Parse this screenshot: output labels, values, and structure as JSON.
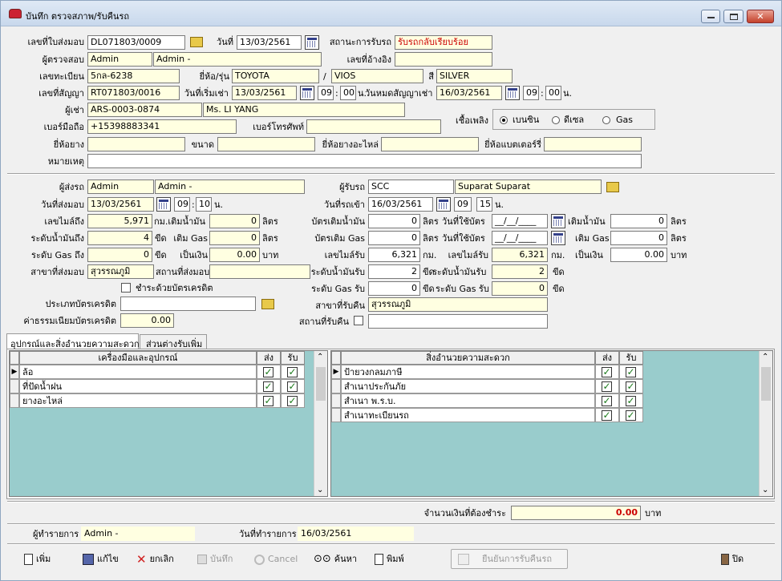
{
  "window": {
    "title": "บันทึก ตรวจสภาพ/รับคืนรถ"
  },
  "head": {
    "l_delivery_no": "เลขที่ใบส่งมอบ",
    "delivery_no": "DL071803/0009",
    "l_date": "วันที่",
    "date": "13/03/2561",
    "l_status": "สถานะการรับรถ",
    "status": "รับรถกลับเรียบร้อย",
    "l_inspector": "ผู้ตรวจสอบ",
    "inspector_code": "Admin",
    "inspector_name": "Admin -",
    "l_ref_no": "เลขที่อ้างอิง",
    "ref_no": "",
    "l_plate": "เลขทะเบียน",
    "plate": "5กล-6238",
    "l_brand_model": "ยี่ห้อ/รุ่น",
    "brand": "TOYOTA",
    "slash": "/",
    "model": "VIOS",
    "l_color": "สี",
    "color": "SILVER",
    "l_contract_no": "เลขที่สัญญา",
    "contract_no": "RT071803/0016",
    "l_rent_start": "วันที่เริ่มเช่า",
    "rent_start": "13/03/2561",
    "start_h": "09",
    "start_m": "00",
    "l_n1": "น.",
    "l_contract_end": "วันหมดสัญญาเช่า",
    "contract_end": "16/03/2561",
    "end_h": "09",
    "end_m": "00",
    "l_n2": "น.",
    "l_renter": "ผู้เช่า",
    "renter_code": "ARS-0003-0874",
    "renter_name": "Ms. LI YANG",
    "l_mobile": "เบอร์มือถือ",
    "mobile": "+15398883341",
    "l_phone": "เบอร์โทรศัพท์",
    "phone": "",
    "l_fuel": "เชื้อเพลิง",
    "fuel_options": [
      "เบนซิน",
      "ดีเซล",
      "Gas"
    ],
    "l_tire_brand": "ยี่ห้อยาง",
    "tire_brand": "",
    "l_size": "ขนาด",
    "size": "",
    "l_spare_brand": "ยี่ห้อยางอะไหล่",
    "spare_brand": "",
    "l_battery": "ยี่ห้อแบตเตอร์รี่",
    "battery": "",
    "l_note": "หมายเหตุ",
    "note": ""
  },
  "left": {
    "l_sender": "ผู้ส่งรถ",
    "sender_code": "Admin",
    "sender_name": "Admin -",
    "l_send_date": "วันที่ส่งมอบ",
    "send_date": "13/03/2561",
    "send_h": "09",
    "send_m": "10",
    "l_n": "น.",
    "l_mileage": "เลขไมล์ถึง",
    "mileage": "5,971",
    "l_fuel_add": "กม.เติมน้ำมัน",
    "fuel_add": "0",
    "l_liter1": "ลิตร",
    "l_fuel_level": "ระดับน้ำมันถึง",
    "fuel_level": "4",
    "l_bar1": "ขีด",
    "l_gas_add": "เติม Gas",
    "gas_add": "0",
    "l_liter2": "ลิตร",
    "l_gas_level": "ระดับ Gas ถึง",
    "gas_level": "0",
    "l_bar2": "ขีด",
    "l_amount": "เป็นเงิน",
    "amount": "0.00",
    "l_baht": "บาท",
    "l_branch": "สาขาที่ส่งมอบ",
    "branch": "สุวรรณภูมิ",
    "l_place": "สถานที่ส่งมอบ",
    "place": "",
    "l_pay_credit": "ชำระด้วยบัตรเครดิต",
    "l_card_type": "ประเภทบัตรเครดิต",
    "card_type": "",
    "l_fee": "ค่าธรรมเนียมบัตรเครดิต",
    "fee": "0.00"
  },
  "right": {
    "l_receiver": "ผู้รับรถ",
    "receiver_code": "SCC",
    "receiver_name": "Suparat Suparat",
    "l_recv_date": "วันที่รถเข้า",
    "recv_date": "16/03/2561",
    "recv_h": "09",
    "recv_m": "15",
    "l_n": "น.",
    "l_fuel_card": "บัตรเติมน้ำมัน",
    "fuel_card": "0",
    "l_liter1": "ลิตร",
    "l_card_date1": "วันที่ใช้บัตร",
    "card_date1": "__/__/____",
    "l_refuel": "เติมน้ำมัน",
    "refuel": "0",
    "l_liter2": "ลิตร",
    "l_gas_card": "บัตรเติม Gas",
    "gas_card": "0",
    "l_liter3": "ลิตร",
    "l_card_date2": "วันที่ใช้บัตร",
    "card_date2": "__/__/____",
    "l_regas": "เติม Gas",
    "regas": "0",
    "l_liter4": "ลิตร",
    "l_mileage_in": "เลขไมล์รับ",
    "mileage_in": "6,321",
    "l_km1": "กม.",
    "l_mileage_in2": "เลขไมล์รับ",
    "mileage_in2": "6,321",
    "l_km2": "กม.",
    "l_amount": "เป็นเงิน",
    "amount": "0.00",
    "l_baht": "บาท",
    "l_fuel_in": "ระดับน้ำมันรับ",
    "fuel_in": "2",
    "l_bar1": "ขีด",
    "l_fuel_in2": "ระดับน้ำมันรับ",
    "fuel_in2": "2",
    "l_bar2": "ขีด",
    "l_gas_in": "ระดับ Gas รับ",
    "gas_in": "0",
    "l_bar3": "ขีด",
    "l_gas_in2": "ระดับ Gas รับ",
    "gas_in2": "0",
    "l_bar4": "ขีด",
    "l_branch": "สาขาที่รับคืน",
    "branch": "สุวรรณภูมิ",
    "l_place": "สถานที่รับคืน",
    "place": ""
  },
  "tabs": [
    "อุปกรณ์และสิ่งอำนวยความสะดวก",
    "ส่วนต่างรับเพิ่ม"
  ],
  "equipment": {
    "h_name": "เครื่องมือและอุปกรณ์",
    "h_send": "ส่ง",
    "h_recv": "รับ",
    "rows": [
      {
        "name": "ล้อ"
      },
      {
        "name": "ที่ปัดน้ำฝน"
      },
      {
        "name": "ยางอะไหล่"
      }
    ]
  },
  "facilities": {
    "h_name": "สิ่งอำนวยความสะดวก",
    "h_send": "ส่ง",
    "h_recv": "รับ",
    "rows": [
      {
        "name": "ป้ายวงกลมภาษี"
      },
      {
        "name": "สำเนาประกันภัย"
      },
      {
        "name": "สำเนา พ.ร.บ."
      },
      {
        "name": "สำเนาทะเบียนรถ"
      }
    ]
  },
  "summary": {
    "l_due": "จำนวนเงินที่ต้องชำระ",
    "due": "0.00",
    "l_baht": "บาท"
  },
  "footer": {
    "l_operator": "ผู้ทำรายการ",
    "operator": "Admin -",
    "l_op_date": "วันที่ทำรายการ",
    "op_date": "16/03/2561"
  },
  "toolbar": {
    "add": "เพิ่ม",
    "edit": "แก้ไข",
    "cancel_doc": "ยกเลิก",
    "save": "บันทึก",
    "cancel": "Cancel",
    "search": "ค้นหา",
    "print": "พิมพ์",
    "confirm": "ยืนยันการรับคืนรถ",
    "close": "ปิด"
  },
  "colors": {
    "status": "#cc0000",
    "grid_bg": "#99cccc",
    "due": "#cc0000"
  }
}
